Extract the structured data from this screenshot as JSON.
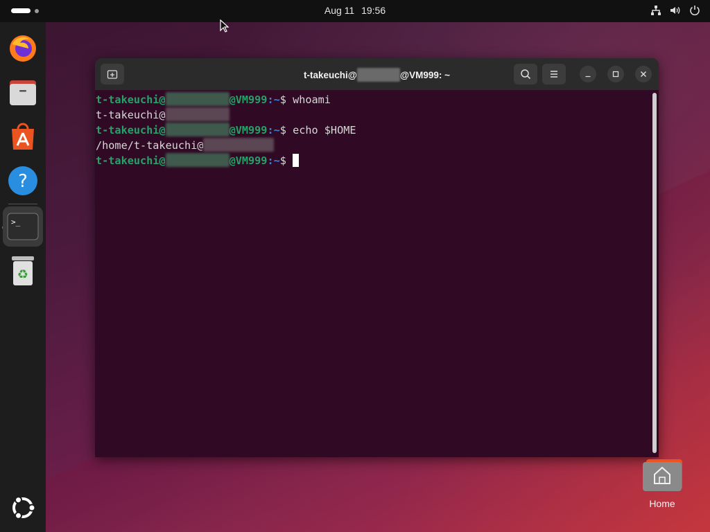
{
  "topbar": {
    "date": "Aug 11",
    "time": "19:56",
    "tray_icons": [
      "network-icon",
      "volume-icon",
      "power-icon"
    ]
  },
  "dock": {
    "items": [
      {
        "name": "firefox",
        "icon": "firefox-icon"
      },
      {
        "name": "files",
        "icon": "files-icon"
      },
      {
        "name": "app-center",
        "icon": "app-center-icon"
      },
      {
        "name": "help",
        "icon": "help-icon"
      },
      {
        "name": "terminal",
        "icon": "terminal-icon",
        "running": true,
        "focused": true
      },
      {
        "name": "trash",
        "icon": "trash-icon"
      }
    ],
    "apps_grid_icon": "ubuntu-logo-icon"
  },
  "terminal": {
    "title_prefix": "t-takeuchi@",
    "title_suffix": "@VM999: ~",
    "prompt_user": "t-takeuchi@",
    "prompt_host": "@VM999",
    "prompt_path": ":~",
    "prompt_symbol": "$ ",
    "lines": [
      {
        "command": "whoami"
      },
      {
        "output": "t-takeuchi@"
      },
      {
        "command": "echo $HOME"
      },
      {
        "output": "/home/t-takeuchi@"
      }
    ]
  },
  "desktop": {
    "home_label": "Home"
  },
  "colors": {
    "terminal_bg": "#300a24",
    "prompt_green": "#26a269",
    "prompt_blue": "#3f7fd6",
    "accent_orange": "#e95420"
  }
}
